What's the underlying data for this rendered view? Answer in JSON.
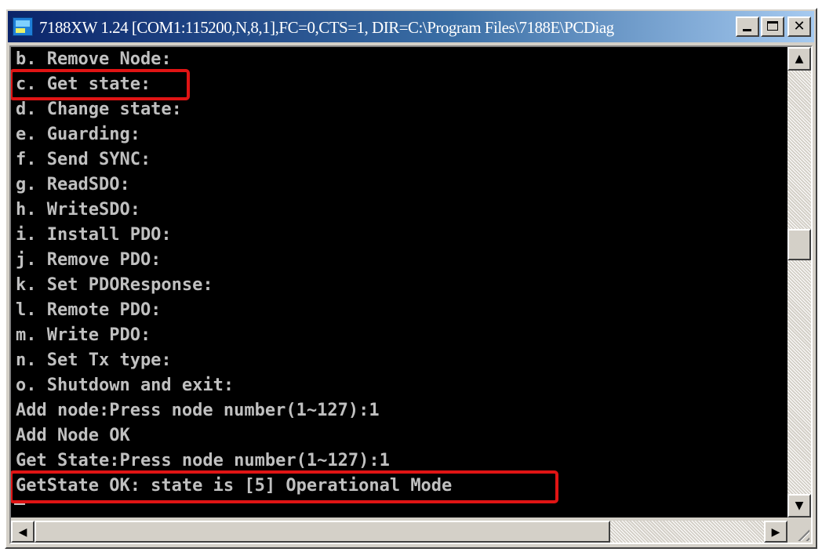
{
  "window": {
    "title": "7188XW 1.24 [COM1:115200,N,8,1],FC=0,CTS=1, DIR=C:\\Program Files\\7188E\\PCDiag",
    "app_icon": "console-app-icon",
    "controls": {
      "minimize_icon": "minimize-icon",
      "maximize_icon": "maximize-icon",
      "close_label": "✕"
    }
  },
  "console": {
    "lines": [
      "b. Remove Node:",
      "c. Get state:",
      "d. Change state:",
      "e. Guarding:",
      "f. Send SYNC:",
      "g. ReadSDO:",
      "h. WriteSDO:",
      "i. Install PDO:",
      "j. Remove PDO:",
      "k. Set PDOResponse:",
      "l. Remote PDO:",
      "m. Write PDO:",
      "n. Set Tx type:",
      "o. Shutdown and exit:",
      "Add node:Press node number(1~127):1",
      "Add Node OK",
      "Get State:Press node number(1~127):1",
      "GetState OK: state is [5] Operational Mode"
    ],
    "text_color": "#c0c0c0",
    "background": "#000000",
    "highlight_color": "#e01414"
  },
  "scrollbars": {
    "up_arrow": "▲",
    "down_arrow": "▼",
    "left_arrow": "◀",
    "right_arrow": "▶"
  }
}
